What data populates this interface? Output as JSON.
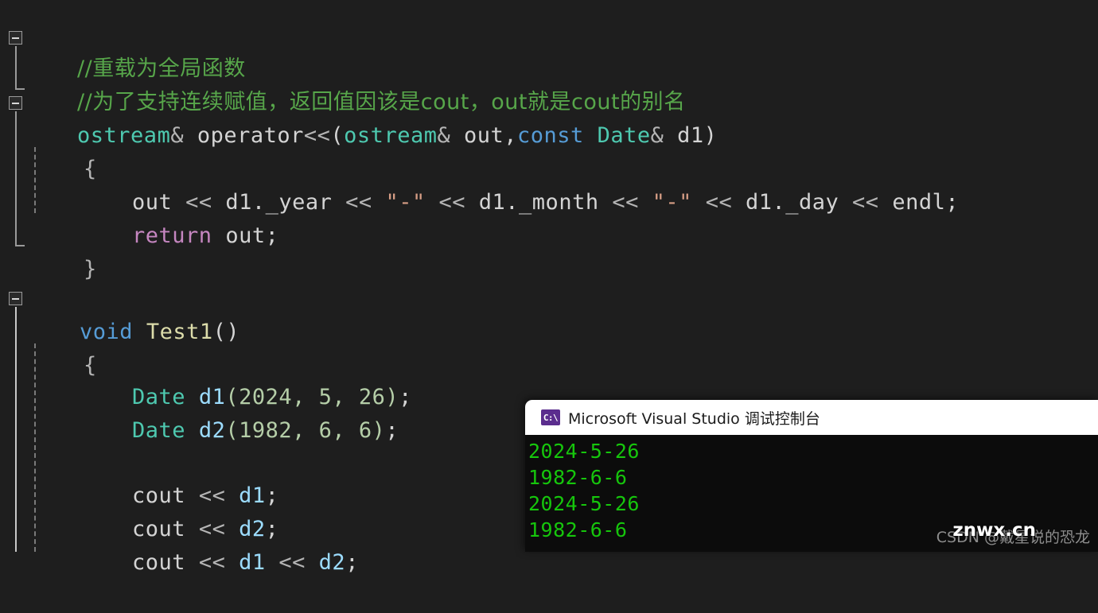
{
  "editor": {
    "background": "#1e1e1e",
    "colors": {
      "comment": "#57a64a",
      "type": "#4ec9b0",
      "keyword": "#569cd6",
      "control": "#c586c0",
      "function": "#dcdcaa",
      "variable": "#9cdcfe",
      "number": "#b5cea8",
      "string": "#d69d85",
      "plain": "#d4d4d4"
    },
    "lines": [
      {
        "id": "l1",
        "text": "//重载为全局函数"
      },
      {
        "id": "l2",
        "text": "//为了支持连续赋值，返回值因该是cout，out就是cout的别名"
      },
      {
        "id": "l3",
        "text": "ostream& operator<<(ostream& out,const Date& d1)"
      },
      {
        "id": "l4",
        "text": "{"
      },
      {
        "id": "l5",
        "text": "    out << d1._year << \"-\" << d1._month << \"-\" << d1._day << endl;"
      },
      {
        "id": "l6",
        "text": "    return out;"
      },
      {
        "id": "l7",
        "text": "}"
      },
      {
        "id": "l8",
        "text": ""
      },
      {
        "id": "l9",
        "text": "void Test1()"
      },
      {
        "id": "l10",
        "text": "{"
      },
      {
        "id": "l11",
        "text": "    Date d1(2024, 5, 26);"
      },
      {
        "id": "l12",
        "text": "    Date d2(1982, 6, 6);"
      },
      {
        "id": "l13",
        "text": ""
      },
      {
        "id": "l14",
        "text": "    cout << d1;"
      },
      {
        "id": "l15",
        "text": "    cout << d2;"
      },
      {
        "id": "l16",
        "text": "    cout << d1 << d2;"
      }
    ],
    "tokens": {
      "l1": {
        "comment": "//重载为全局函数"
      },
      "l2": {
        "comment": "//为了支持连续赋值，返回值因该是cout，out就是cout的别名"
      },
      "l3": {
        "type1": "ostream",
        "amp1": "& ",
        "fn": "operator",
        "op1": "<<",
        "paren_open": "(",
        "type2": "ostream",
        "amp2": "& ",
        "param1": "out",
        "comma": ",",
        "kw": "const",
        "space": " ",
        "type3": "Date",
        "amp3": "& ",
        "param2": "d1",
        "paren_close": ")"
      },
      "l4": {
        "brace": "{"
      },
      "l5": {
        "obj": "out",
        "op": "<<",
        "m1": "d1._year",
        "s1": "\"-\"",
        "m2": "d1._month",
        "s2": "\"-\"",
        "m3": "d1._day",
        "endl": "endl",
        "semi": ";"
      },
      "l6": {
        "ctrl": "return",
        "obj": "out",
        "semi": ";"
      },
      "l7": {
        "brace": "}"
      },
      "l9": {
        "kw": "void",
        "fn": "Test1",
        "parens": "()"
      },
      "l10": {
        "brace": "{"
      },
      "l11": {
        "type": "Date",
        "var": "d1",
        "args": "(2024, 5, 26)",
        "semi": ";"
      },
      "l12": {
        "type": "Date",
        "var": "d2",
        "args": "(1982, 6, 6)",
        "semi": ";"
      },
      "l14": {
        "obj": "cout",
        "op": "<<",
        "var": "d1",
        "semi": ";"
      },
      "l15": {
        "obj": "cout",
        "op": "<<",
        "var": "d2",
        "semi": ";"
      },
      "l16": {
        "obj": "cout",
        "op1": "<<",
        "var1": "d1",
        "op2": "<<",
        "var2": "d2",
        "semi": ";"
      }
    }
  },
  "console": {
    "title": "Microsoft Visual Studio 调试控制台",
    "icon_label": "C:\\",
    "icon_color": "#5b2d8e",
    "text_color": "#16c60c",
    "background": "#0c0c0c",
    "output": [
      "2024-5-26",
      "1982-6-6",
      "2024-5-26",
      "1982-6-6"
    ]
  },
  "watermarks": {
    "csdn": "CSDN @戴星说的恐龙",
    "site": "znwx.cn"
  }
}
